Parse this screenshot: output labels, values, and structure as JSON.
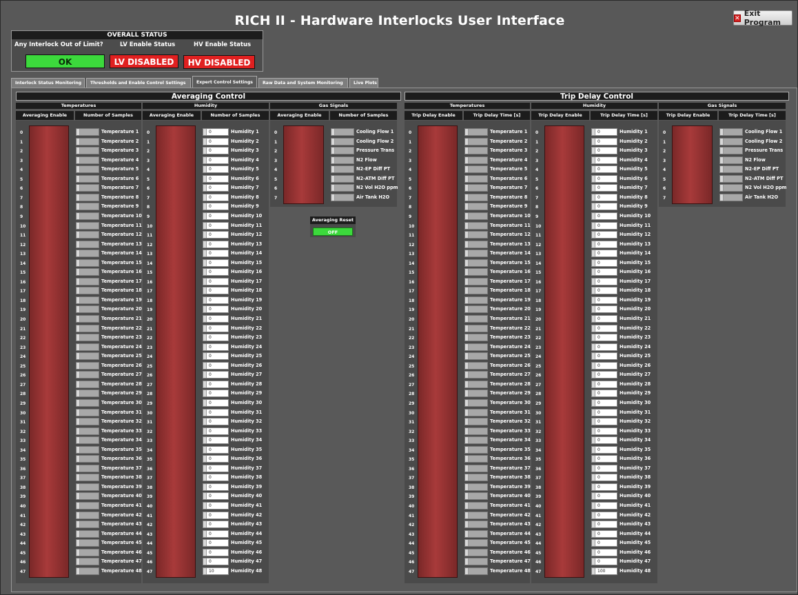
{
  "window": {
    "title": "RICH II - Hardware Interlocks User Interface",
    "exit_label": "Exit Program"
  },
  "overall": {
    "header": "OVERALL STATUS",
    "labels": [
      "Any Interlock Out of Limit?",
      "LV Enable Status",
      "HV Enable Status"
    ],
    "values": [
      "OK",
      "LV DISABLED",
      "HV DISABLED"
    ],
    "colors": {
      "ok": "#3cd93c",
      "disabled": "#e02020"
    }
  },
  "tabs": [
    "Interlock Status Monitoring",
    "Thresholds and Enable Control Settings",
    "Expert Control Settings",
    "Raw Data and System Monitoring",
    "Live Plots"
  ],
  "active_tab": "Expert Control Settings",
  "averaging": {
    "title": "Averaging Control",
    "groups": [
      "Temperatures",
      "Humidity",
      "Gas Signals"
    ],
    "cols": [
      "Averaging Enable",
      "Number of Samples"
    ],
    "humidity_samples": [
      "0",
      "0",
      "0",
      "0",
      "0",
      "0",
      "0",
      "0",
      "0",
      "0",
      "0",
      "0",
      "0",
      "0",
      "0",
      "0",
      "0",
      "0",
      "0",
      "0",
      "0",
      "0",
      "0",
      "0",
      "0",
      "0",
      "0",
      "0",
      "0",
      "0",
      "0",
      "0",
      "0",
      "0",
      "0",
      "0",
      "0",
      "0",
      "0",
      "0",
      "0",
      "0",
      "0",
      "0",
      "0",
      "0",
      "0",
      "10"
    ],
    "reset_label": "Averaging Reset",
    "reset_value": "OFF"
  },
  "trip": {
    "title": "Trip Delay Control",
    "groups": [
      "Temperatures",
      "Humidity",
      "Gas Signals"
    ],
    "cols": [
      "Trip Delay Enable",
      "Trip Delay Time [s]"
    ],
    "humidity_times": [
      "0",
      "0",
      "0",
      "0",
      "0",
      "0",
      "0",
      "0",
      "0",
      "0",
      "0",
      "0",
      "0",
      "0",
      "0",
      "0",
      "0",
      "0",
      "0",
      "0",
      "0",
      "0",
      "0",
      "0",
      "0",
      "0",
      "0",
      "0",
      "0",
      "0",
      "0",
      "0",
      "0",
      "0",
      "0",
      "0",
      "0",
      "0",
      "0",
      "0",
      "0",
      "0",
      "0",
      "0",
      "0",
      "0",
      "0",
      "100"
    ]
  },
  "indices48": [
    "0",
    "1",
    "2",
    "3",
    "4",
    "5",
    "6",
    "7",
    "8",
    "9",
    "10",
    "11",
    "12",
    "13",
    "14",
    "15",
    "16",
    "17",
    "18",
    "19",
    "20",
    "21",
    "22",
    "23",
    "24",
    "25",
    "26",
    "27",
    "28",
    "29",
    "30",
    "31",
    "32",
    "33",
    "34",
    "35",
    "36",
    "37",
    "38",
    "39",
    "40",
    "41",
    "42",
    "43",
    "44",
    "45",
    "46",
    "47"
  ],
  "temps": [
    "Temperature 1",
    "Temperature 2",
    "Temperature 3",
    "Temperature 4",
    "Temperature 5",
    "Temperature 6",
    "Temperature 7",
    "Temperature 8",
    "Temperature 9",
    "Temperature 10",
    "Temperature 11",
    "Temperature 12",
    "Temperature 13",
    "Temperature 14",
    "Temperature 15",
    "Temperature 16",
    "Temperature 17",
    "Temperature 18",
    "Temperature 19",
    "Temperature 20",
    "Temperature 21",
    "Temperature 22",
    "Temperature 23",
    "Temperature 24",
    "Temperature 25",
    "Temperature 26",
    "Temperature 27",
    "Temperature 28",
    "Temperature 29",
    "Temperature 30",
    "Temperature 31",
    "Temperature 32",
    "Temperature 33",
    "Temperature 34",
    "Temperature 35",
    "Temperature 36",
    "Temperature 37",
    "Temperature 38",
    "Temperature 39",
    "Temperature 40",
    "Temperature 41",
    "Temperature 42",
    "Temperature 43",
    "Temperature 44",
    "Temperature 45",
    "Temperature 46",
    "Temperature 47",
    "Temperature 48"
  ],
  "hums": [
    "Humidity 1",
    "Humidity 2",
    "Humidity 3",
    "Humidity 4",
    "Humidity 5",
    "Humidity 6",
    "Humidity 7",
    "Humidity 8",
    "Humidity 9",
    "Humidity 10",
    "Humidity 11",
    "Humidity 12",
    "Humidity 13",
    "Humidity 14",
    "Humidity 15",
    "Humidity 16",
    "Humidity 17",
    "Humidity 18",
    "Humidity 19",
    "Humidity 20",
    "Humidity 21",
    "Humidity 22",
    "Humidity 23",
    "Humidity 24",
    "Humidity 25",
    "Humidity 26",
    "Humidity 27",
    "Humidity 28",
    "Humidity 29",
    "Humidity 30",
    "Humidity 31",
    "Humidity 32",
    "Humidity 33",
    "Humidity 34",
    "Humidity 35",
    "Humidity 36",
    "Humidity 37",
    "Humidity 38",
    "Humidity 39",
    "Humidity 40",
    "Humidity 41",
    "Humidity 42",
    "Humidity 43",
    "Humidity 44",
    "Humidity 45",
    "Humidity 46",
    "Humidity 47",
    "Humidity 48"
  ],
  "indices8": [
    "0",
    "1",
    "2",
    "3",
    "4",
    "5",
    "6",
    "7"
  ],
  "gas": [
    "Cooling Flow 1",
    "Cooling Flow 2",
    "Pressure Trans",
    "N2 Flow",
    "N2-EP Diff PT",
    "N2-ATM Diff PT",
    "N2 Vol H2O ppm",
    "Air Tank H2O"
  ]
}
